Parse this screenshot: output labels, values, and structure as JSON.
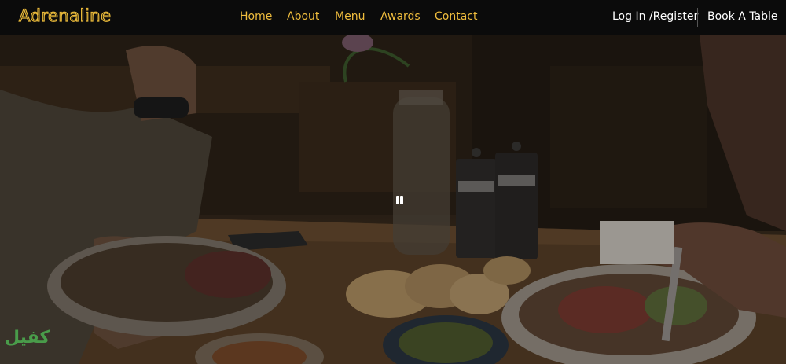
{
  "brand": {
    "logo": "Adrenaline"
  },
  "nav": {
    "links": [
      "Home",
      "About",
      "Menu",
      "Awards",
      "Contact"
    ],
    "login": "Log In /Register",
    "book": "Book A Table"
  },
  "hero": {
    "video_state": "playing",
    "pause_icon": "pause-icon"
  },
  "watermark": {
    "text": "كفيل"
  },
  "colors": {
    "accent": "#f0bd3d",
    "navbar": "#0b0b0b",
    "text": "#ffffff"
  }
}
